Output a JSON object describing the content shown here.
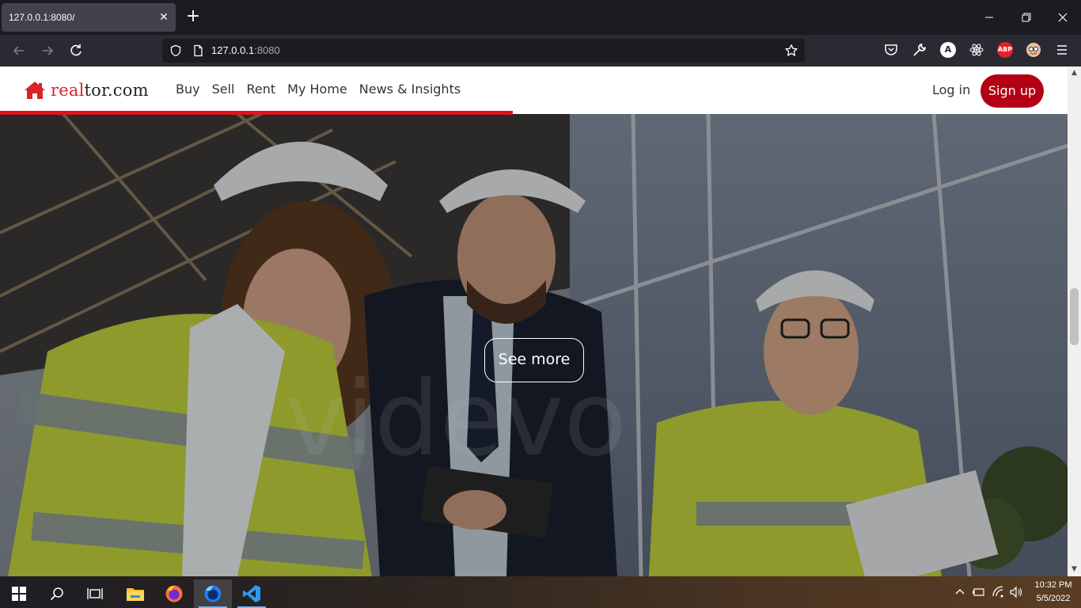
{
  "browser": {
    "tab_title": "127.0.0.1:8080/",
    "url_host": "127.0.0.1",
    "url_port": ":8080",
    "extensions": [
      "pocket-icon",
      "wrench-icon",
      "a-icon",
      "react-icon",
      "adblock-icon",
      "avatar-icon",
      "menu-icon"
    ],
    "adblock_label": "ABP",
    "a_label": "A"
  },
  "site": {
    "logo_red": "real",
    "logo_dark": "tor.com",
    "nav": [
      "Buy",
      "Sell",
      "Rent",
      "My Home",
      "News & Insights"
    ],
    "login": "Log in",
    "signup": "Sign up",
    "scroll_progress": 0.48,
    "hero_cta": "See more",
    "watermark": "videvo",
    "accent": "#e1141c",
    "signup_bg": "#b40014"
  },
  "taskbar": {
    "time": "10:32 PM",
    "date": "5/5/2022"
  }
}
